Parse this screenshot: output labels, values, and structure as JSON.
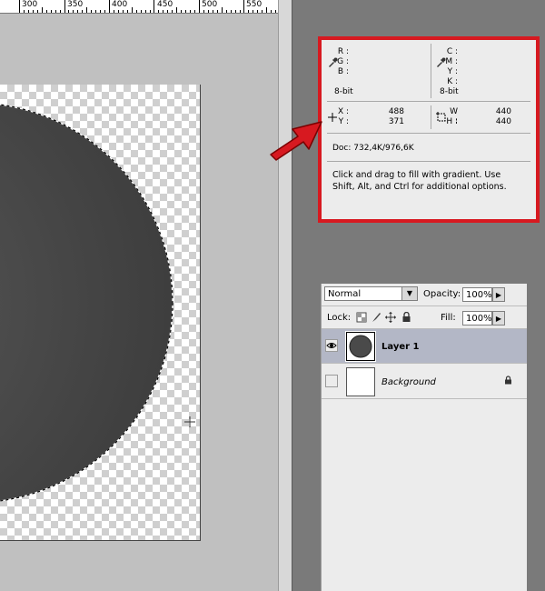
{
  "ruler": {
    "labels": [
      "300",
      "350",
      "400",
      "450",
      "500",
      "550"
    ]
  },
  "info_panel": {
    "rgb_labels": [
      "R :",
      "G :",
      "B :"
    ],
    "cmyk_labels": [
      "C :",
      "M :",
      "Y :",
      "K :"
    ],
    "bit_left": "8-bit",
    "bit_right": "8-bit",
    "x_label": "X :",
    "x_value": "488",
    "y_label": "Y :",
    "y_value": "371",
    "w_label": "W :",
    "w_value": "440",
    "h_label": "H :",
    "h_value": "440",
    "doc": "Doc: 732,4K/976,6K",
    "message": "Click and drag to fill with gradient.  Use Shift, Alt, and Ctrl for additional options."
  },
  "layers_panel": {
    "blend_mode": "Normal",
    "opacity_label": "Opacity:",
    "opacity_value": "100%",
    "lock_label": "Lock:",
    "fill_label": "Fill:",
    "fill_value": "100%",
    "layers": [
      {
        "name": "Layer 1",
        "selected": true,
        "visible": true
      },
      {
        "name": "Background",
        "selected": false,
        "visible": false,
        "locked": true
      }
    ]
  },
  "colors": {
    "highlight_border": "#d71920",
    "selected_layer": "#b3b7c6",
    "panel_bg": "#ececec"
  }
}
